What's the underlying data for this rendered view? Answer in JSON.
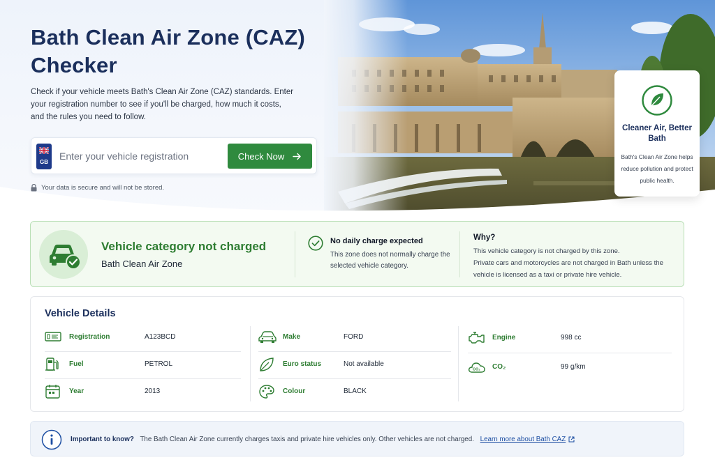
{
  "hero": {
    "title": "Bath Clean Air Zone (CAZ) Checker",
    "intro": "Check if your vehicle meets Bath's Clean Air Zone (CAZ) standards. Enter your registration number to see if you'll be charged, how much it costs, and the rules you need to follow.",
    "search": {
      "country_code": "GB",
      "placeholder": "Enter your vehicle registration",
      "value": "",
      "button_label": "Check Now"
    },
    "secure_note": "Your data is secure and will not be stored.",
    "side_card": {
      "title": "Cleaner Air, Better Bath",
      "description": "Bath's Clean Air Zone helps reduce pollution and protect public health."
    }
  },
  "result": {
    "title": "Vehicle category not charged",
    "subtitle": "Bath Clean Air Zone",
    "no_charge": {
      "title": "No daily charge expected",
      "description": "This zone does not normally charge the selected vehicle category."
    },
    "why": {
      "title": "Why?",
      "line1": "This vehicle category is not charged by this zone.",
      "line2": "Private cars and motorcycles are not charged in Bath unless the vehicle is licensed as a taxi or private hire vehicle."
    }
  },
  "details": {
    "title": "Vehicle Details",
    "col1": [
      {
        "label": "Registration",
        "value": "A123BCD",
        "icon": "registration-plate-icon"
      },
      {
        "label": "Fuel",
        "value": "PETROL",
        "icon": "fuel-pump-icon"
      },
      {
        "label": "Year",
        "value": "2013",
        "icon": "calendar-icon"
      }
    ],
    "col2": [
      {
        "label": "Make",
        "value": "FORD",
        "icon": "car-icon"
      },
      {
        "label": "Euro status",
        "value": "Not available",
        "icon": "leaf-icon"
      },
      {
        "label": "Colour",
        "value": "BLACK",
        "icon": "palette-icon"
      }
    ],
    "col3": [
      {
        "label": "Engine",
        "value": "998 cc",
        "icon": "engine-icon"
      },
      {
        "label": "CO₂",
        "value": "99 g/km",
        "icon": "co2-cloud-icon"
      }
    ]
  },
  "info": {
    "heading": "Important to know?",
    "text": "The Bath Clean Air Zone currently charges taxis and private hire vehicles only. Other vehicles are not charged.",
    "link": "Learn more about Bath CAZ"
  },
  "colors": {
    "brand_navy": "#1b2f5c",
    "accent_green": "#2f8a3e",
    "success_bg": "#f3faf1",
    "info_bg": "#f0f4fa"
  }
}
